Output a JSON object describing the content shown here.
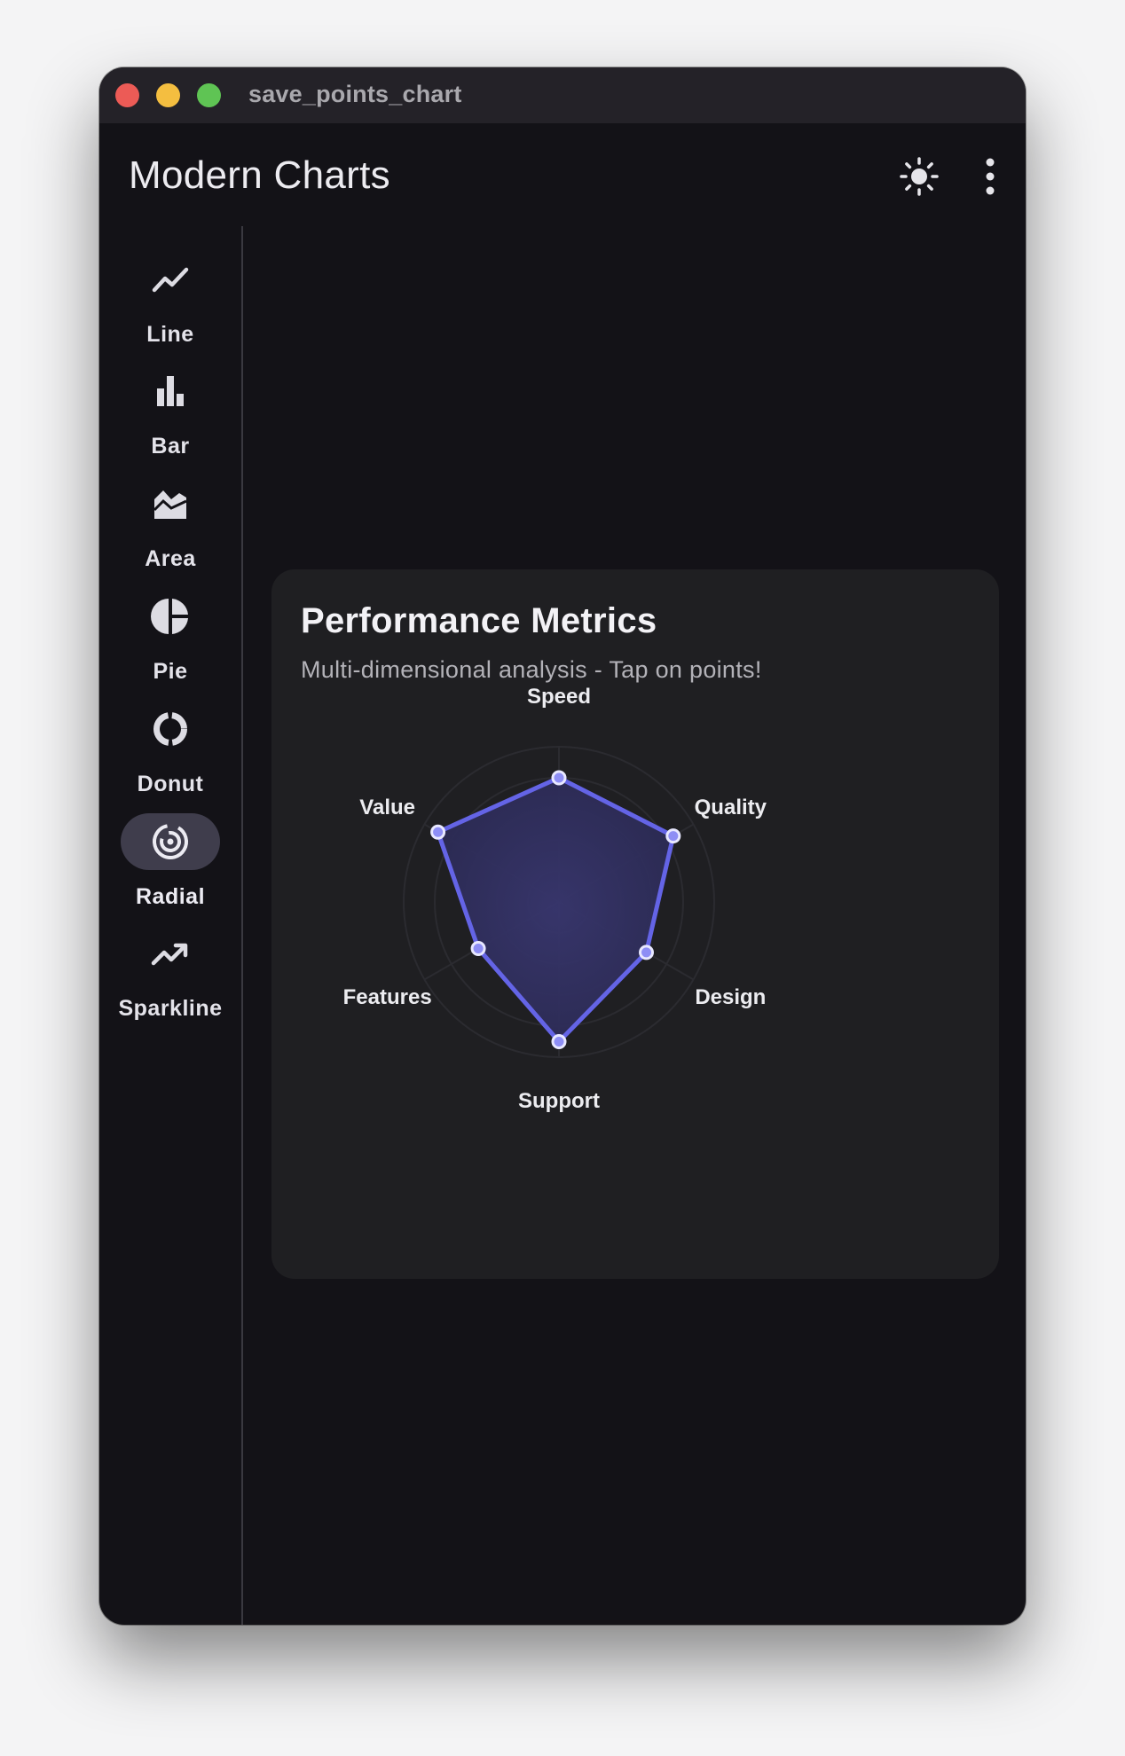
{
  "window": {
    "title": "save_points_chart"
  },
  "appbar": {
    "title": "Modern Charts",
    "theme_icon": "sun-icon",
    "more_icon": "more-vert-icon"
  },
  "sidebar": {
    "items": [
      {
        "label": "Line",
        "icon": "line-chart-icon",
        "active": false
      },
      {
        "label": "Bar",
        "icon": "bar-chart-icon",
        "active": false
      },
      {
        "label": "Area",
        "icon": "area-chart-icon",
        "active": false
      },
      {
        "label": "Pie",
        "icon": "pie-chart-icon",
        "active": false
      },
      {
        "label": "Donut",
        "icon": "donut-chart-icon",
        "active": false
      },
      {
        "label": "Radial",
        "icon": "radial-chart-icon",
        "active": true
      },
      {
        "label": "Sparkline",
        "icon": "trending-up-icon",
        "active": false
      }
    ]
  },
  "card": {
    "title": "Performance Metrics",
    "subtitle": "Multi-dimensional analysis - Tap on points!"
  },
  "chart_data": {
    "type": "radar",
    "categories": [
      "Speed",
      "Quality",
      "Design",
      "Support",
      "Features",
      "Value"
    ],
    "values": [
      80,
      85,
      65,
      90,
      60,
      90
    ],
    "rlim": [
      0,
      100
    ],
    "grid": true,
    "colors": {
      "line": "#6464e6",
      "fill": "#3b3a78",
      "point_fill": "#8e8ef5",
      "point_stroke": "#e8e8ff"
    }
  }
}
